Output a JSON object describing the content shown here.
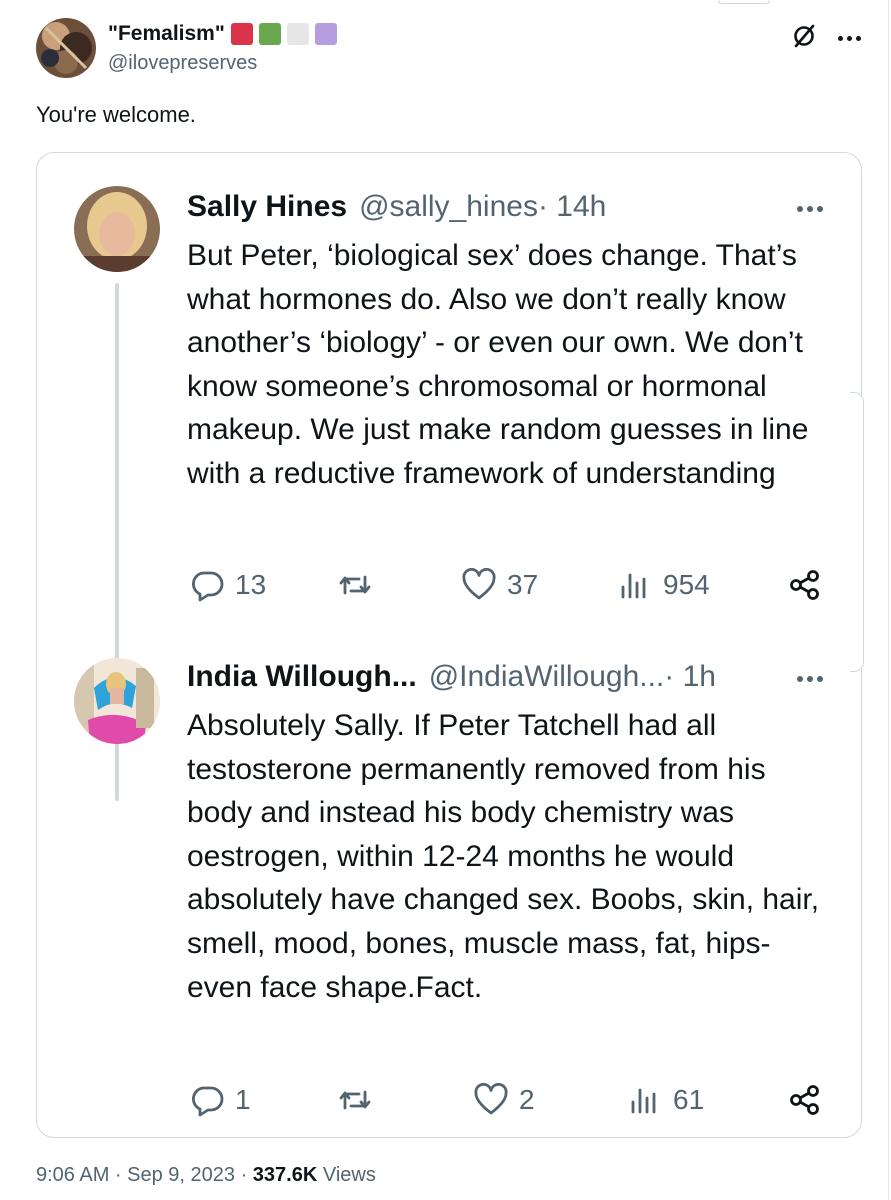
{
  "outer_tweet": {
    "author_name": "\"Femalism\"",
    "handle": "@ilovepreserves",
    "flag_colors": [
      "#d9344a",
      "#6aa84f",
      "#e6e6e6",
      "#b59ddf"
    ],
    "text": "You're welcome.",
    "timestamp": "9:06 AM · Sep 9, 2023 · ",
    "views_count": "337.6K",
    "views_label": " Views"
  },
  "quoted_thread": [
    {
      "author_name": "Sally Hines",
      "handle": "@sally_hines",
      "time": " · 14h",
      "text": "But Peter, ‘biological sex’ does change. That’s what hormones do. Also we don’t really know another’s ‘biology’ - or even our own. We don’t know someone’s chromosomal or hormonal makeup. We just make random guesses in line with a reductive framework of understanding",
      "replies": "13",
      "retweets": "",
      "likes": "37",
      "views": "954"
    },
    {
      "author_name": "India Willough...",
      "handle": "@IndiaWillough...",
      "time": " · 1h",
      "text": "Absolutely Sally. If Peter Tatchell had all testosterone permanently removed from his body and instead his body chemistry was oestrogen, within 12-24 months he would  absolutely have changed sex. Boobs, skin, hair, smell, mood, bones, muscle mass, fat, hips- even face shape.Fact.",
      "replies": "1",
      "retweets": "",
      "likes": "2",
      "views": "61"
    }
  ],
  "icons": {
    "more": "more-horizontal-icon",
    "grok": "grok-slash-icon",
    "reply": "reply-bubble-icon",
    "retweet": "retweet-arrows-icon",
    "like": "heart-icon",
    "views": "bar-chart-icon",
    "share": "share-nodes-icon"
  },
  "colors": {
    "text": "#0f1419",
    "muted": "#536471",
    "border": "#cfd9de"
  }
}
